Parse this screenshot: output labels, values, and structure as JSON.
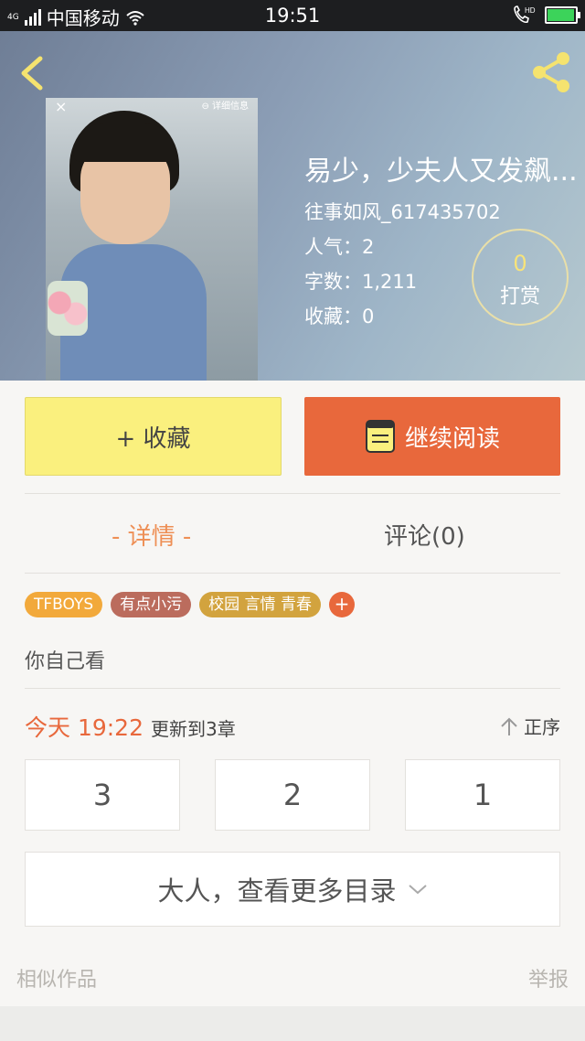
{
  "status_bar": {
    "network": "4G",
    "carrier": "中国移动",
    "time": "19:51",
    "hd": "HD",
    "battery_percent": 90
  },
  "work": {
    "title": "易少，少夫人又发飙...",
    "author": "往事如风_617435702",
    "popularity": "人气：2",
    "word_count": "字数：1,211",
    "favorites": "收藏：0",
    "cover_overlay_close": "×",
    "cover_overlay_info": "⊖ 详细信息"
  },
  "reward": {
    "count": "0",
    "label": "打赏"
  },
  "buttons": {
    "favorite": "+ 收藏",
    "continue_reading": "继续阅读"
  },
  "tabs": {
    "detail": "- 详情 -",
    "comments": "评论(0)"
  },
  "tags": [
    {
      "label": "TFBOYS",
      "color": "#f2a93b"
    },
    {
      "label": "有点小污",
      "color": "#bb6c5d"
    },
    {
      "label": "校园 言情 青春",
      "color": "#d2a33e"
    }
  ],
  "tag_add_label": "+",
  "description": "你自己看",
  "update": {
    "time": "今天 19:22",
    "text": "更新到3章"
  },
  "order": {
    "label": "正序",
    "icon": "arrow-up-icon"
  },
  "chapters": [
    "3",
    "2",
    "1"
  ],
  "more_catalog": "大人，查看更多目录",
  "footer": {
    "similar": "相似作品",
    "report": "举报"
  },
  "colors": {
    "accent": "#e8683c",
    "favorite_button": "#faf07e",
    "tab_active": "#ee8f55"
  }
}
